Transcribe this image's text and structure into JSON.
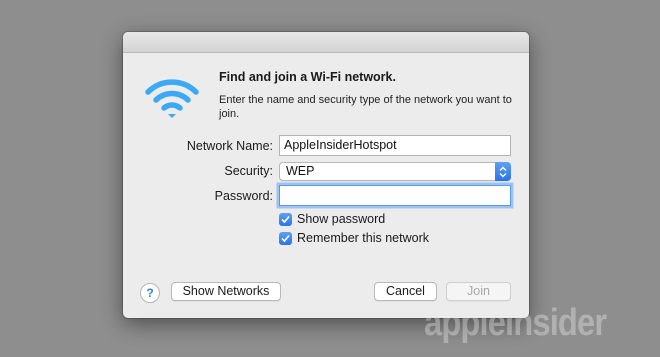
{
  "dialog": {
    "heading": "Find and join a Wi-Fi network.",
    "description": "Enter the name and security type of the network you want to join.",
    "icon": "wifi-icon"
  },
  "form": {
    "network_name_label": "Network Name:",
    "network_name_value": "AppleInsiderHotspot",
    "security_label": "Security:",
    "security_value": "WEP",
    "password_label": "Password:",
    "password_value": ""
  },
  "options": {
    "show_password": "Show password",
    "remember_network": "Remember this network"
  },
  "buttons": {
    "help": "?",
    "show_networks": "Show Networks",
    "cancel": "Cancel",
    "join": "Join"
  },
  "watermark": "appleinsider",
  "colors": {
    "accent": "#3a8ee6",
    "wifi": "#3da8f5",
    "background": "#8e8e8e"
  }
}
